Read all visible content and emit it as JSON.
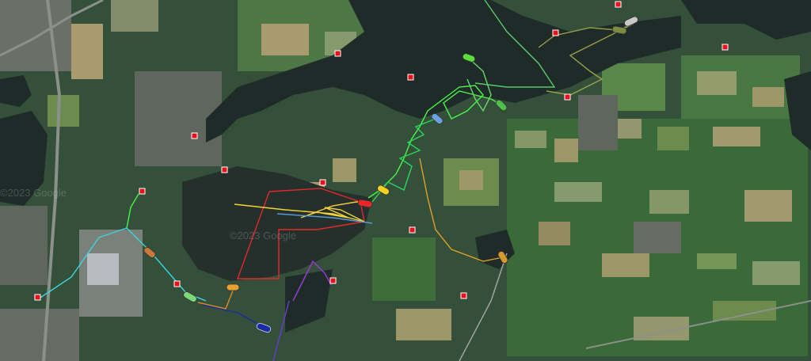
{
  "map": {
    "watermark_text": "©2023 Google",
    "markers": [
      "waypoint-1",
      "waypoint-2",
      "waypoint-3",
      "waypoint-4",
      "waypoint-5",
      "waypoint-6",
      "waypoint-7",
      "waypoint-8",
      "waypoint-9",
      "waypoint-10",
      "waypoint-11",
      "waypoint-12",
      "waypoint-13",
      "waypoint-14",
      "waypoint-15",
      "waypoint-16",
      "waypoint-17",
      "waypoint-18"
    ],
    "boats": [
      {
        "id": "boat-grey",
        "color": "#c8c8c8"
      },
      {
        "id": "boat-olive",
        "color": "#7d8c44"
      },
      {
        "id": "boat-lime",
        "color": "#5ede3a"
      },
      {
        "id": "boat-green",
        "color": "#4cc24a"
      },
      {
        "id": "boat-blue",
        "color": "#6aa0dc"
      },
      {
        "id": "boat-yellow",
        "color": "#f5d020"
      },
      {
        "id": "boat-red",
        "color": "#e62828"
      },
      {
        "id": "boat-brown",
        "color": "#c77a3a"
      },
      {
        "id": "boat-orange",
        "color": "#d49a2a"
      },
      {
        "id": "boat-light-green",
        "color": "#7ed87a"
      },
      {
        "id": "boat-orange-2",
        "color": "#e8a030"
      },
      {
        "id": "boat-navy",
        "color": "#1a2aa8"
      }
    ],
    "track_colors": {
      "cyan": "#3ad6e0",
      "lime": "#4cf24c",
      "yellow": "#f2d23a",
      "red": "#e02a2a",
      "orange": "#e0a028",
      "purple": "#9a3ad6",
      "steelblue": "#5a9ad6",
      "green": "#2ad65a"
    }
  }
}
